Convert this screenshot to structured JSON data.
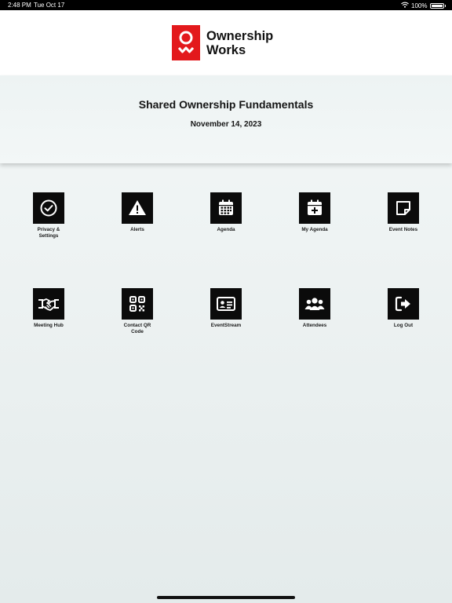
{
  "status_bar": {
    "time": "2:48 PM",
    "date": "Tue Oct 17",
    "battery": "100%"
  },
  "header": {
    "brand_line1": "Ownership",
    "brand_line2": "Works",
    "brand_color": "#e3191c"
  },
  "hero": {
    "title": "Shared Ownership Fundamentals",
    "date": "November 14, 2023"
  },
  "tiles": [
    {
      "label": "Privacy & Settings",
      "icon": "check-circle-icon"
    },
    {
      "label": "Alerts",
      "icon": "warning-icon"
    },
    {
      "label": "Agenda",
      "icon": "calendar-grid-icon"
    },
    {
      "label": "My Agenda",
      "icon": "calendar-plus-icon"
    },
    {
      "label": "Event Notes",
      "icon": "note-icon"
    },
    {
      "label": "Meeting Hub",
      "icon": "handshake-icon"
    },
    {
      "label": "Contact QR Code",
      "icon": "qr-code-icon"
    },
    {
      "label": "EventStream",
      "icon": "id-card-icon"
    },
    {
      "label": "Attendees",
      "icon": "users-icon"
    },
    {
      "label": "Log Out",
      "icon": "logout-icon"
    }
  ]
}
